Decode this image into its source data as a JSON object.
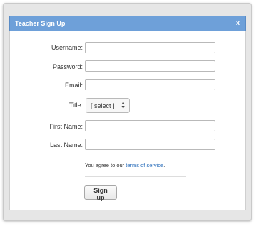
{
  "dialog": {
    "title": "Teacher Sign Up",
    "close_label": "x"
  },
  "form": {
    "username_label": "Username:",
    "password_label": "Password:",
    "email_label": "Email:",
    "title_label": "Title:",
    "title_select_value": "[ select ]",
    "first_name_label": "First Name:",
    "last_name_label": "Last Name:",
    "username_value": "",
    "password_value": "",
    "email_value": "",
    "first_name_value": "",
    "last_name_value": ""
  },
  "terms": {
    "prefix": "You agree to our ",
    "link_text": "terms of service",
    "suffix": "."
  },
  "actions": {
    "signup_label": "Sign up"
  },
  "colors": {
    "titlebar": "#6ea0d9",
    "link": "#2a6ebb"
  },
  "icons": {
    "close": "close-icon",
    "select_arrows": "up-down-arrows-icon"
  }
}
